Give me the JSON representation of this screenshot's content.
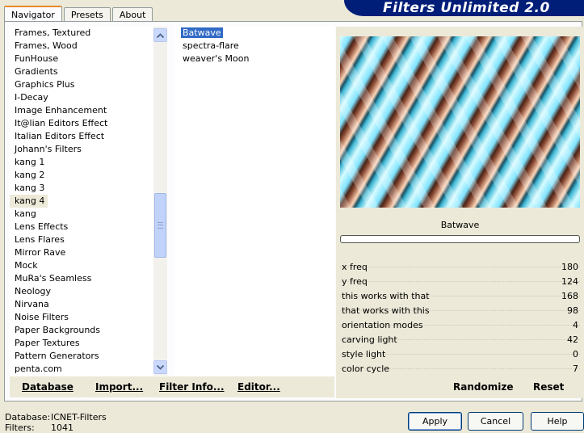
{
  "tabs": [
    {
      "label": "Navigator",
      "active": true
    },
    {
      "label": "Presets",
      "active": false
    },
    {
      "label": "About",
      "active": false
    }
  ],
  "banner_title": "Filters Unlimited 2.0",
  "categories": [
    "Frames, Textured",
    "Frames, Wood",
    "FunHouse",
    "Gradients",
    "Graphics Plus",
    "I-Decay",
    "Image Enhancement",
    "It@lian Editors Effect",
    "Italian Editors Effect",
    "Johann's Filters",
    "kang 1",
    "kang 2",
    "kang 3",
    "kang 4",
    "kang",
    "Lens Effects",
    "Lens Flares",
    "Mirror Rave",
    "Mock",
    "MuRa's Seamless",
    "Neology",
    "Nirvana",
    "Noise Filters",
    "Paper Backgrounds",
    "Paper Textures",
    "Pattern Generators",
    "penta.com"
  ],
  "selected_category": "kang 4",
  "filters": [
    "Batwave",
    "spectra-flare",
    "weaver's Moon"
  ],
  "selected_filter": "Batwave",
  "list_buttons": {
    "database": "Database",
    "import": "Import...",
    "filter_info": "Filter Info...",
    "editor": "Editor..."
  },
  "preview_filter_name": "Batwave",
  "params": [
    {
      "label": "x freq",
      "value": "180"
    },
    {
      "label": "y freq",
      "value": "124"
    },
    {
      "label": "this works with that",
      "value": "168"
    },
    {
      "label": "that works with this",
      "value": "98"
    },
    {
      "label": "orientation modes",
      "value": "4"
    },
    {
      "label": "carving light",
      "value": "42"
    },
    {
      "label": "style light",
      "value": "0"
    },
    {
      "label": "color cycle",
      "value": "7"
    }
  ],
  "right_buttons": {
    "randomize": "Randomize",
    "reset": "Reset"
  },
  "status": {
    "database_label": "Database:",
    "database_value": "ICNET-Filters",
    "filters_label": "Filters:",
    "filters_value": "1041"
  },
  "dialog_buttons": {
    "apply": "Apply",
    "cancel": "Cancel",
    "help": "Help"
  }
}
